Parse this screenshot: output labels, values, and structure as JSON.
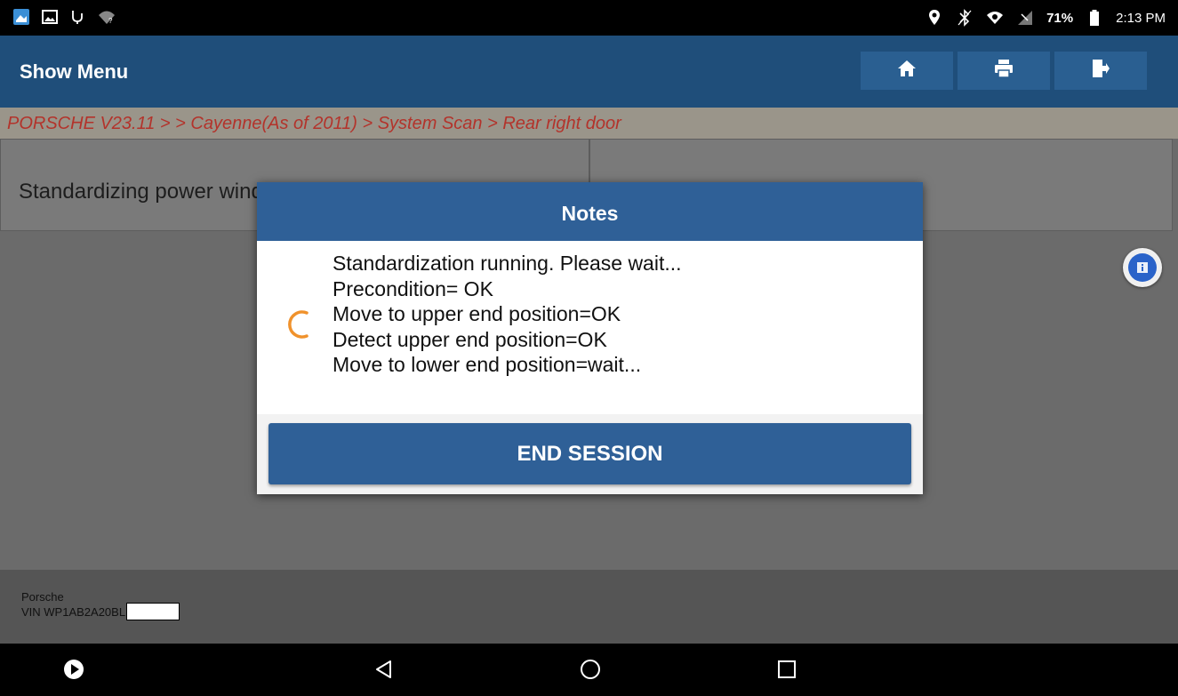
{
  "status_bar": {
    "left_icons": [
      "app-icon",
      "image-icon",
      "usb-icon",
      "wifi-question-icon"
    ],
    "right_icons": [
      "location-icon",
      "bluetooth-icon",
      "wifi-icon",
      "no-signal-icon"
    ],
    "battery": "71%",
    "time": "2:13 PM"
  },
  "header": {
    "title": "Show Menu",
    "buttons": [
      "home-icon",
      "print-icon",
      "exit-icon"
    ]
  },
  "breadcrumb": "PORSCHE V23.11 >  > Cayenne(As of 2011) > System Scan > Rear right door",
  "menu": {
    "item_label": "Standardizing power windows"
  },
  "dialog": {
    "title": "Notes",
    "lines": [
      "Standardization running. Please wait...",
      "Precondition= OK",
      "Move to upper end position=OK",
      "Detect upper end position=OK",
      "Move to lower end position=wait..."
    ],
    "button_label": "END SESSION"
  },
  "footer": {
    "make": "Porsche",
    "vin": "VIN WP1AB2A20BL"
  },
  "colors": {
    "header": "#1f4e7a",
    "dialog_header": "#2f6097",
    "breadcrumb_text": "#b3332b",
    "spinner": "#f0922c"
  }
}
